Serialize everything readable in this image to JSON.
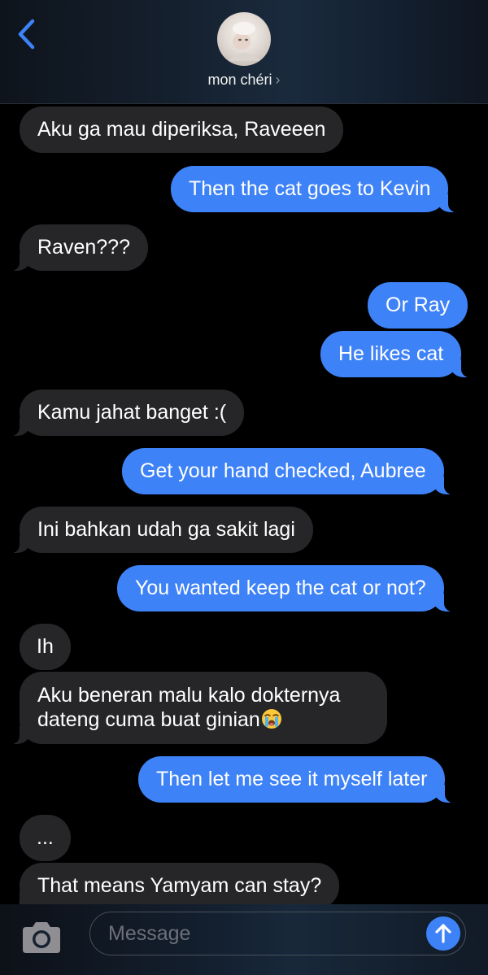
{
  "header": {
    "contact_name": "mon chéri",
    "chevron": "›"
  },
  "messages": [
    {
      "direction": "in",
      "text": "Aku ga mau diperiksa, Raveeen"
    },
    {
      "direction": "out",
      "text": "Then the cat goes to Kevin"
    },
    {
      "direction": "in",
      "text": "Raven???"
    },
    {
      "direction": "out",
      "text": "Or Ray"
    },
    {
      "direction": "out",
      "text": "He likes cat"
    },
    {
      "direction": "in",
      "text": "Kamu jahat banget :("
    },
    {
      "direction": "out",
      "text": "Get your hand checked, Aubree"
    },
    {
      "direction": "in",
      "text": "Ini bahkan udah ga sakit lagi"
    },
    {
      "direction": "out",
      "text": "You wanted keep the cat or not?"
    },
    {
      "direction": "in",
      "text": "Ih"
    },
    {
      "direction": "in",
      "text_line1": "Aku beneran malu kalo dokternya",
      "text_line2": "dateng cuma buat ginian",
      "emoji": "loudly-crying-face"
    },
    {
      "direction": "out",
      "text": "Then let me see it myself later"
    },
    {
      "direction": "in",
      "text": "..."
    },
    {
      "direction": "in",
      "text": "That means Yamyam can stay?"
    }
  ],
  "input": {
    "placeholder": "Message"
  },
  "icons": {
    "back": "chevron-left-icon",
    "camera": "camera-icon",
    "send": "arrow-up-icon"
  },
  "colors": {
    "outgoing_bubble": "#3e82f7",
    "incoming_bubble": "#262628",
    "accent": "#3e82f7"
  }
}
